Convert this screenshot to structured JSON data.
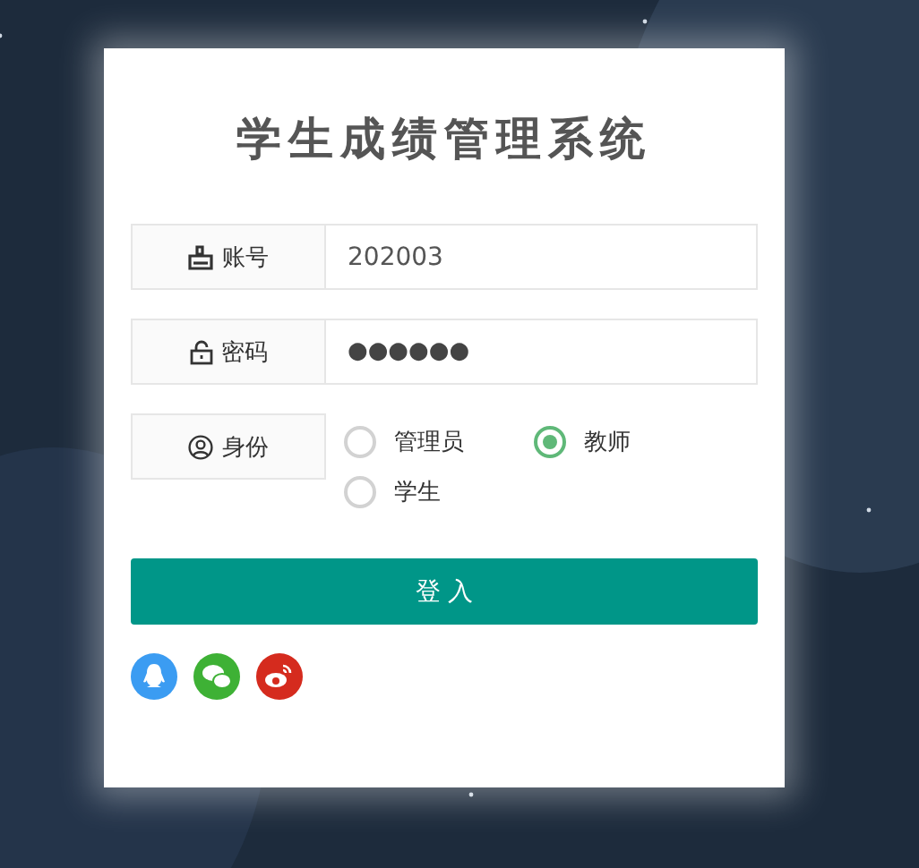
{
  "title": "学生成绩管理系统",
  "fields": [
    {
      "kind": "text",
      "label": "账号",
      "value": "202003"
    },
    {
      "kind": "password",
      "label": "密码",
      "value": "●●●●●●"
    }
  ],
  "role": {
    "label": "身份",
    "options": [
      {
        "label": "管理员",
        "selected": false
      },
      {
        "label": "教师",
        "selected": true
      },
      {
        "label": "学生",
        "selected": false
      }
    ]
  },
  "login_button": "登 入"
}
